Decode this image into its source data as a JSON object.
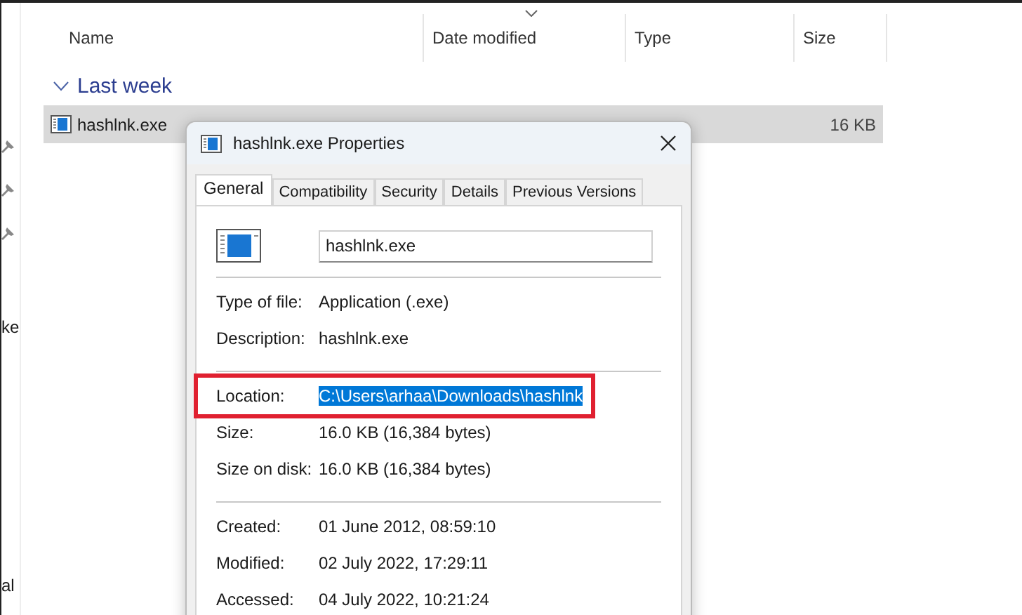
{
  "nav_pane": {
    "items": [
      "ke",
      "al"
    ]
  },
  "columns": [
    {
      "label": "Name",
      "sorted": false
    },
    {
      "label": "Date modified",
      "sorted": true
    },
    {
      "label": "Type",
      "sorted": false
    },
    {
      "label": "Size",
      "sorted": false
    }
  ],
  "group": {
    "label": "Last week",
    "expanded": true
  },
  "rows": [
    {
      "name": "hashlnk.exe",
      "size": "16 KB",
      "selected": true
    }
  ],
  "dialog": {
    "title": "hashlnk.exe Properties",
    "tabs": [
      {
        "label": "General",
        "selected": true
      },
      {
        "label": "Compatibility",
        "selected": false
      },
      {
        "label": "Security",
        "selected": false
      },
      {
        "label": "Details",
        "selected": false
      },
      {
        "label": "Previous Versions",
        "selected": false
      }
    ],
    "file_name": "hashlnk.exe",
    "sections": [
      [
        {
          "label": "Type of file:",
          "value": "Application (.exe)",
          "highlighted": false,
          "boxed": false
        },
        {
          "label": "Description:",
          "value": "hashlnk.exe",
          "highlighted": false,
          "boxed": false
        }
      ],
      [
        {
          "label": "Location:",
          "value": "C:\\Users\\arhaa\\Downloads\\hashlnk",
          "highlighted": true,
          "boxed": true
        },
        {
          "label": "Size:",
          "value": "16.0 KB (16,384 bytes)",
          "highlighted": false,
          "boxed": false
        },
        {
          "label": "Size on disk:",
          "value": "16.0 KB (16,384 bytes)",
          "highlighted": false,
          "boxed": false
        }
      ],
      [
        {
          "label": "Created:",
          "value": "01 June 2012, 08:59:10",
          "highlighted": false,
          "boxed": false
        },
        {
          "label": "Modified:",
          "value": "02 July 2022, 17:29:11",
          "highlighted": false,
          "boxed": false
        },
        {
          "label": "Accessed:",
          "value": "04 July 2022, 10:21:24",
          "highlighted": false,
          "boxed": false
        }
      ]
    ]
  }
}
